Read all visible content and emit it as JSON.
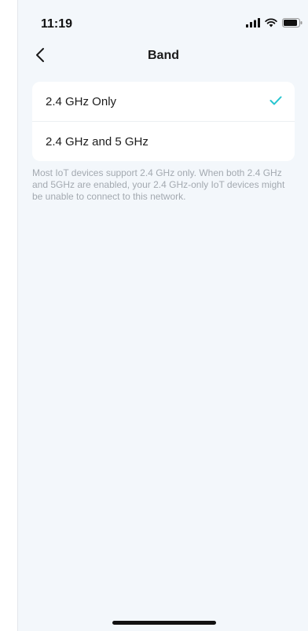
{
  "status_bar": {
    "time": "11:19",
    "icons": [
      "cellular-signal-icon",
      "wifi-icon",
      "battery-icon"
    ]
  },
  "nav": {
    "back_icon": "chevron-left-icon",
    "title": "Band"
  },
  "band_options": [
    {
      "label": "2.4 GHz Only",
      "selected": true
    },
    {
      "label": "2.4 GHz and 5 GHz",
      "selected": false
    }
  ],
  "hint": "Most IoT devices support 2.4 GHz only. When both 2.4 GHz and 5GHz are enabled, your 2.4 GHz-only IoT devices might be unable to connect to this network.",
  "colors": {
    "accent": "#27c5d0",
    "background": "#f3f7fb",
    "hint_text": "#a3a9b0"
  }
}
